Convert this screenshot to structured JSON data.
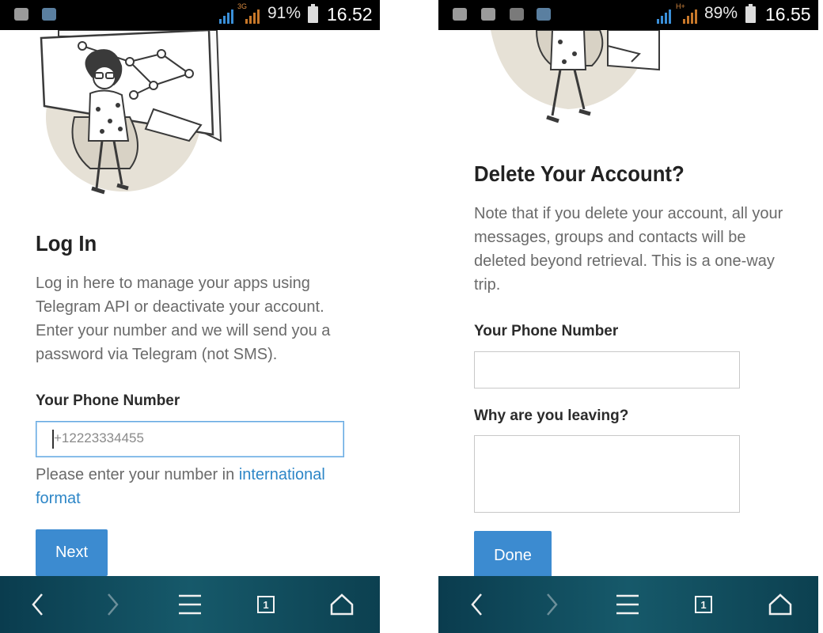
{
  "left_screen": {
    "status_bar": {
      "network": "3G",
      "battery": "91%",
      "time": "16.52"
    },
    "title": "Log In",
    "intro": "Log in here to manage your apps using Telegram API or deactivate your account. Enter your number and we will send you a password via Telegram (not SMS).",
    "phone_label": "Your Phone Number",
    "phone_placeholder": "+12223334455",
    "hint_prefix": "Please enter your number in ",
    "hint_link": "international format",
    "next_label": "Next"
  },
  "right_screen": {
    "status_bar": {
      "network": "H+",
      "battery": "89%",
      "time": "16.55"
    },
    "title": "Delete Your Account?",
    "note": "Note that if you delete your account, all your messages, groups and contacts will be deleted beyond retrieval. This is a one-way trip.",
    "phone_label": "Your Phone Number",
    "reason_label": "Why are you leaving?",
    "done_label": "Done"
  },
  "toolbar": {
    "tab_count": "1",
    "icons": [
      "back-icon",
      "forward-icon",
      "menu-icon",
      "tabs-icon",
      "home-icon"
    ]
  },
  "colors": {
    "accent_blue": "#3c8bd0",
    "link_blue": "#2d86c7",
    "toolbar_teal": "#16596a"
  }
}
